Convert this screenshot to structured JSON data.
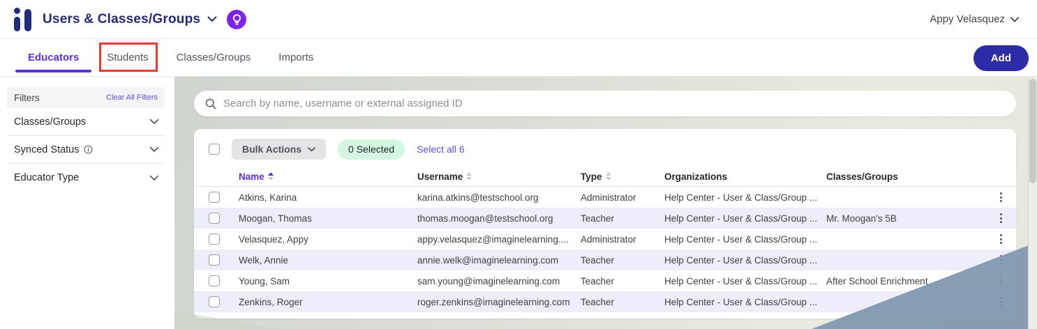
{
  "app": {
    "title": "Users & Classes/Groups",
    "user_name": "Appy Velasquez",
    "add_label": "Add"
  },
  "tabs": [
    {
      "label": "Educators",
      "active": true,
      "annotated": false
    },
    {
      "label": "Students",
      "active": false,
      "annotated": true
    },
    {
      "label": "Classes/Groups",
      "active": false,
      "annotated": false
    },
    {
      "label": "Imports",
      "active": false,
      "annotated": false
    }
  ],
  "filters": {
    "title": "Filters",
    "clear_label": "Clear All Filters",
    "sections": [
      {
        "label": "Classes/Groups",
        "info": false
      },
      {
        "label": "Synced Status",
        "info": true
      },
      {
        "label": "Educator Type",
        "info": false
      }
    ]
  },
  "search": {
    "placeholder": "Search by name, username or external assigned ID"
  },
  "toolbar": {
    "bulk_actions_label": "Bulk Actions",
    "selected_badge": "0 Selected",
    "select_all_label": "Select all 6"
  },
  "table": {
    "columns": [
      {
        "label": "Name",
        "sortable": true,
        "sort": "asc"
      },
      {
        "label": "Username",
        "sortable": true,
        "sort": null
      },
      {
        "label": "Type",
        "sortable": true,
        "sort": null
      },
      {
        "label": "Organizations",
        "sortable": false,
        "sort": null
      },
      {
        "label": "Classes/Groups",
        "sortable": false,
        "sort": null
      }
    ],
    "rows": [
      {
        "name": "Atkins, Karina",
        "username": "karina.atkins@testschool.org",
        "type": "Administrator",
        "organizations": "Help Center - User & Class/Group ...",
        "classes": ""
      },
      {
        "name": "Moogan, Thomas",
        "username": "thomas.moogan@testschool.org",
        "type": "Teacher",
        "organizations": "Help Center - User & Class/Group ...",
        "classes": "Mr. Moogan's 5B"
      },
      {
        "name": "Velasquez, Appy",
        "username": "appy.velasquez@imaginelearning....",
        "type": "Administrator",
        "organizations": "Help Center - User & Class/Group ...",
        "classes": ""
      },
      {
        "name": "Welk, Annie",
        "username": "annie.welk@imaginelearning.com",
        "type": "Teacher",
        "organizations": "Help Center - User & Class/Group ...",
        "classes": ""
      },
      {
        "name": "Young, Sam",
        "username": "sam.young@imaginelearning.com",
        "type": "Teacher",
        "organizations": "Help Center - User & Class/Group ...",
        "classes": "After School Enrichment"
      },
      {
        "name": "Zenkins, Roger",
        "username": "roger.zenkins@imaginelearning.com",
        "type": "Teacher",
        "organizations": "Help Center - User & Class/Group ...",
        "classes": ""
      }
    ]
  },
  "colors": {
    "navy": "#232A7C",
    "accent_purple": "#5B2EE6",
    "link_purple": "#5A51DF",
    "add_button": "#2E2BA6",
    "tour_badge": "#7C24EB",
    "selected_badge_bg": "#D4F7DF",
    "row_alt": "#EEEDFA",
    "annotation_red": "#E8382F",
    "wave_slate": "#7E96AD"
  }
}
